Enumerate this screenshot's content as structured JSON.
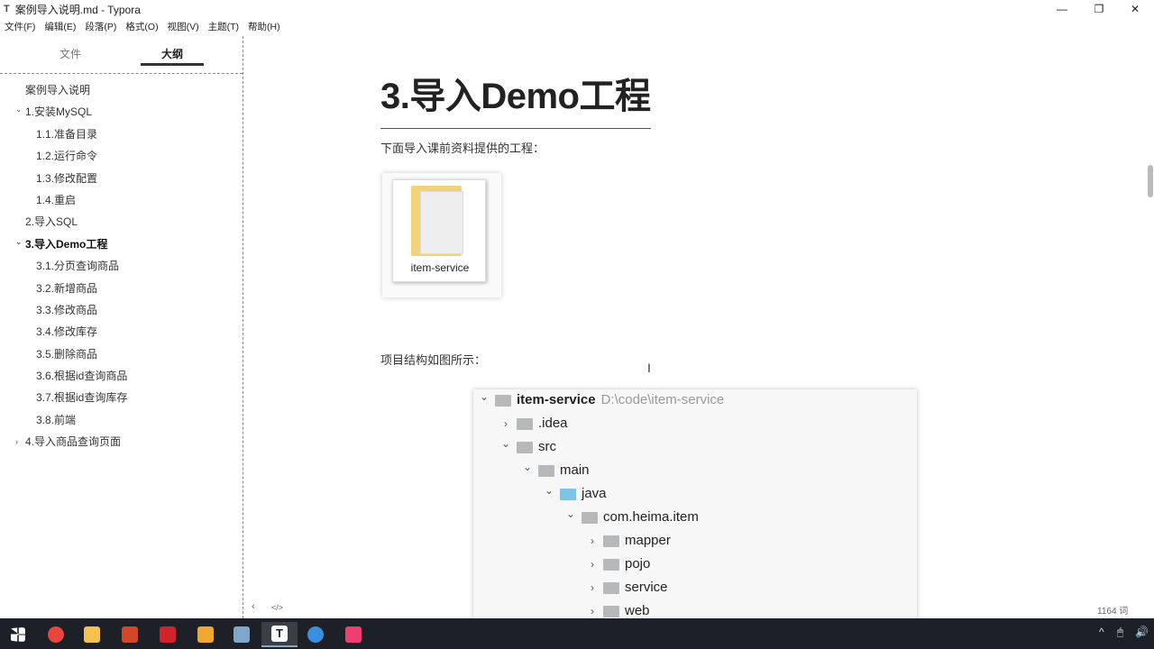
{
  "window": {
    "title": "案例导入说明.md - Typora",
    "app_icon": "T",
    "minimize": "—",
    "restore": "❐",
    "close": "✕"
  },
  "menu": [
    "文件(F)",
    "编辑(E)",
    "段落(P)",
    "格式(O)",
    "视图(V)",
    "主题(T)",
    "帮助(H)"
  ],
  "sidebar": {
    "tabs": [
      "文件",
      "大纲"
    ],
    "active_tab": "大纲",
    "outline": [
      {
        "label": "案例导入说明",
        "level": 0
      },
      {
        "label": "1.安装MySQL",
        "level": 0,
        "toggle": "expanded"
      },
      {
        "label": "1.1.准备目录",
        "level": 1
      },
      {
        "label": "1.2.运行命令",
        "level": 1
      },
      {
        "label": "1.3.修改配置",
        "level": 1
      },
      {
        "label": "1.4.重启",
        "level": 1
      },
      {
        "label": "2.导入SQL",
        "level": 0
      },
      {
        "label": "3.导入Demo工程",
        "level": 0,
        "toggle": "expanded",
        "active": true
      },
      {
        "label": "3.1.分页查询商品",
        "level": 1
      },
      {
        "label": "3.2.新增商品",
        "level": 1
      },
      {
        "label": "3.3.修改商品",
        "level": 1
      },
      {
        "label": "3.4.修改库存",
        "level": 1
      },
      {
        "label": "3.5.删除商品",
        "level": 1
      },
      {
        "label": "3.6.根据id查询商品",
        "level": 1
      },
      {
        "label": "3.7.根据id查询库存",
        "level": 1
      },
      {
        "label": "3.8.前端",
        "level": 1
      },
      {
        "label": "4.导入商品查询页面",
        "level": 0,
        "toggle": "collapsed"
      }
    ]
  },
  "main": {
    "heading": "3.导入Demo工程",
    "para1": "下面导入课前资料提供的工程：",
    "folder_label": "item-service",
    "para2": "项目结构如图所示：",
    "tree": [
      {
        "name": "item-service",
        "path": "D:\\code\\item-service",
        "depth": 0,
        "open": true,
        "bold": true
      },
      {
        "name": ".idea",
        "depth": 1,
        "open": false
      },
      {
        "name": "src",
        "depth": 1,
        "open": true
      },
      {
        "name": "main",
        "depth": 2,
        "open": true
      },
      {
        "name": "java",
        "depth": 3,
        "open": true,
        "color": "blue"
      },
      {
        "name": "com.heima.item",
        "depth": 4,
        "open": true
      },
      {
        "name": "mapper",
        "depth": 5,
        "open": false
      },
      {
        "name": "pojo",
        "depth": 5,
        "open": false
      },
      {
        "name": "service",
        "depth": 5,
        "open": false
      },
      {
        "name": "web",
        "depth": 5,
        "open": false
      }
    ]
  },
  "status": {
    "word_count": "1164 词",
    "back_icon": "‹",
    "source_icon": "</>"
  },
  "taskbar": {
    "apps": [
      {
        "name": "start",
        "color": "#ffffff"
      },
      {
        "name": "chrome",
        "color": "#e8453c"
      },
      {
        "name": "file-explorer",
        "color": "#f2c14e"
      },
      {
        "name": "powerpoint",
        "color": "#d24726"
      },
      {
        "name": "youdao",
        "color": "#d2232a"
      },
      {
        "name": "app-yellow",
        "color": "#f0a830"
      },
      {
        "name": "remote-desktop",
        "color": "#7fa7c9"
      },
      {
        "name": "typora",
        "color": "#ffffff",
        "active": true
      },
      {
        "name": "app-blue",
        "color": "#3b8fe0"
      },
      {
        "name": "intellij",
        "color": "#ee3f6f"
      }
    ],
    "tray": [
      "^",
      "🖱",
      "🔊"
    ]
  }
}
